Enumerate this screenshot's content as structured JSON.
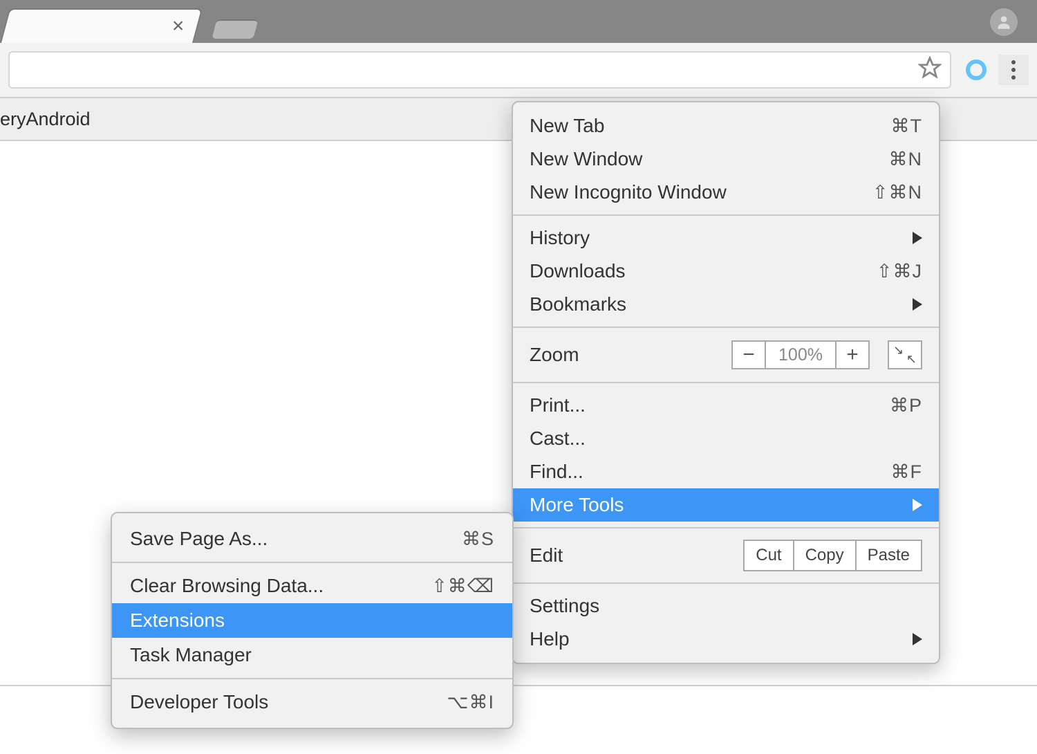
{
  "page": {
    "path_text": "eryAndroid"
  },
  "menu": {
    "new_tab": "New Tab",
    "new_tab_sc": "⌘T",
    "new_window": "New Window",
    "new_window_sc": "⌘N",
    "new_incognito": "New Incognito Window",
    "new_incognito_sc": "⇧⌘N",
    "history": "History",
    "downloads": "Downloads",
    "downloads_sc": "⇧⌘J",
    "bookmarks": "Bookmarks",
    "zoom": "Zoom",
    "zoom_value": "100%",
    "print": "Print...",
    "print_sc": "⌘P",
    "cast": "Cast...",
    "find": "Find...",
    "find_sc": "⌘F",
    "more_tools": "More Tools",
    "edit": "Edit",
    "cut": "Cut",
    "copy": "Copy",
    "paste": "Paste",
    "settings": "Settings",
    "help": "Help"
  },
  "submenu": {
    "save_page_as": "Save Page As...",
    "save_page_as_sc": "⌘S",
    "clear_browsing": "Clear Browsing Data...",
    "clear_browsing_sc": "⇧⌘⌫",
    "extensions": "Extensions",
    "task_manager": "Task Manager",
    "dev_tools": "Developer Tools",
    "dev_tools_sc": "⌥⌘I"
  }
}
